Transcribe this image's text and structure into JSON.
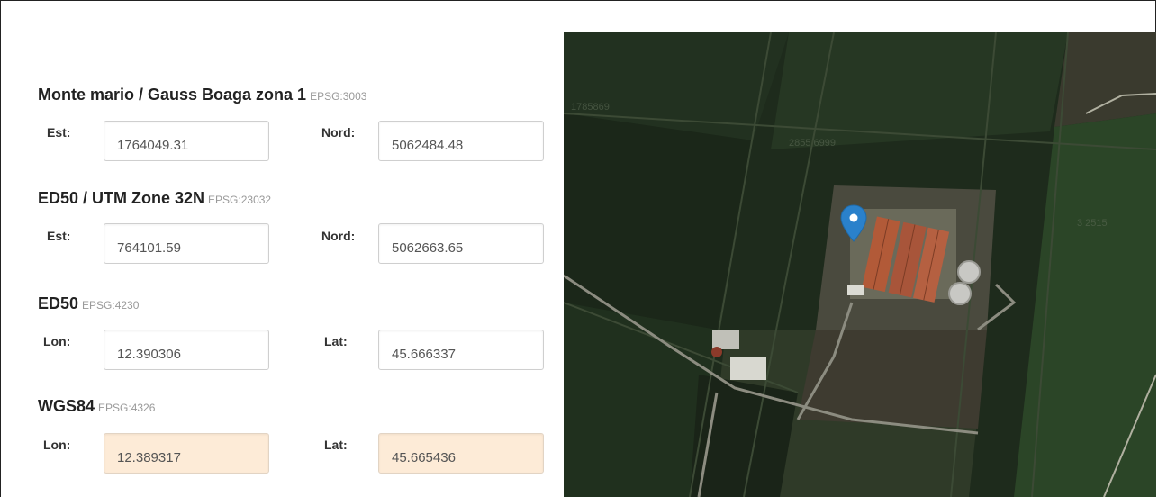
{
  "groups": [
    {
      "title": "Monte mario / Gauss Boaga zona 1",
      "epsg": "EPSG:3003",
      "field1": {
        "label": "Est:",
        "value": "1764049.31"
      },
      "field2": {
        "label": "Nord:",
        "value": "5062484.48"
      }
    },
    {
      "title": "ED50 / UTM Zone 32N",
      "epsg": "EPSG:23032",
      "field1": {
        "label": "Est:",
        "value": "764101.59"
      },
      "field2": {
        "label": "Nord:",
        "value": "5062663.65"
      }
    },
    {
      "title": "ED50",
      "epsg": "EPSG:4230",
      "field1": {
        "label": "Lon:",
        "value": "12.390306"
      },
      "field2": {
        "label": "Lat:",
        "value": "45.666337"
      }
    },
    {
      "title": "WGS84",
      "epsg": "EPSG:4326",
      "field1": {
        "label": "Lon:",
        "value": "12.389317"
      },
      "field2": {
        "label": "Lat:",
        "value": "45.665436"
      }
    }
  ],
  "colors": {
    "highlight_field": "#fdebd7",
    "marker": "#2a81cb"
  },
  "map": {
    "marker_icon": "map-marker-icon"
  }
}
